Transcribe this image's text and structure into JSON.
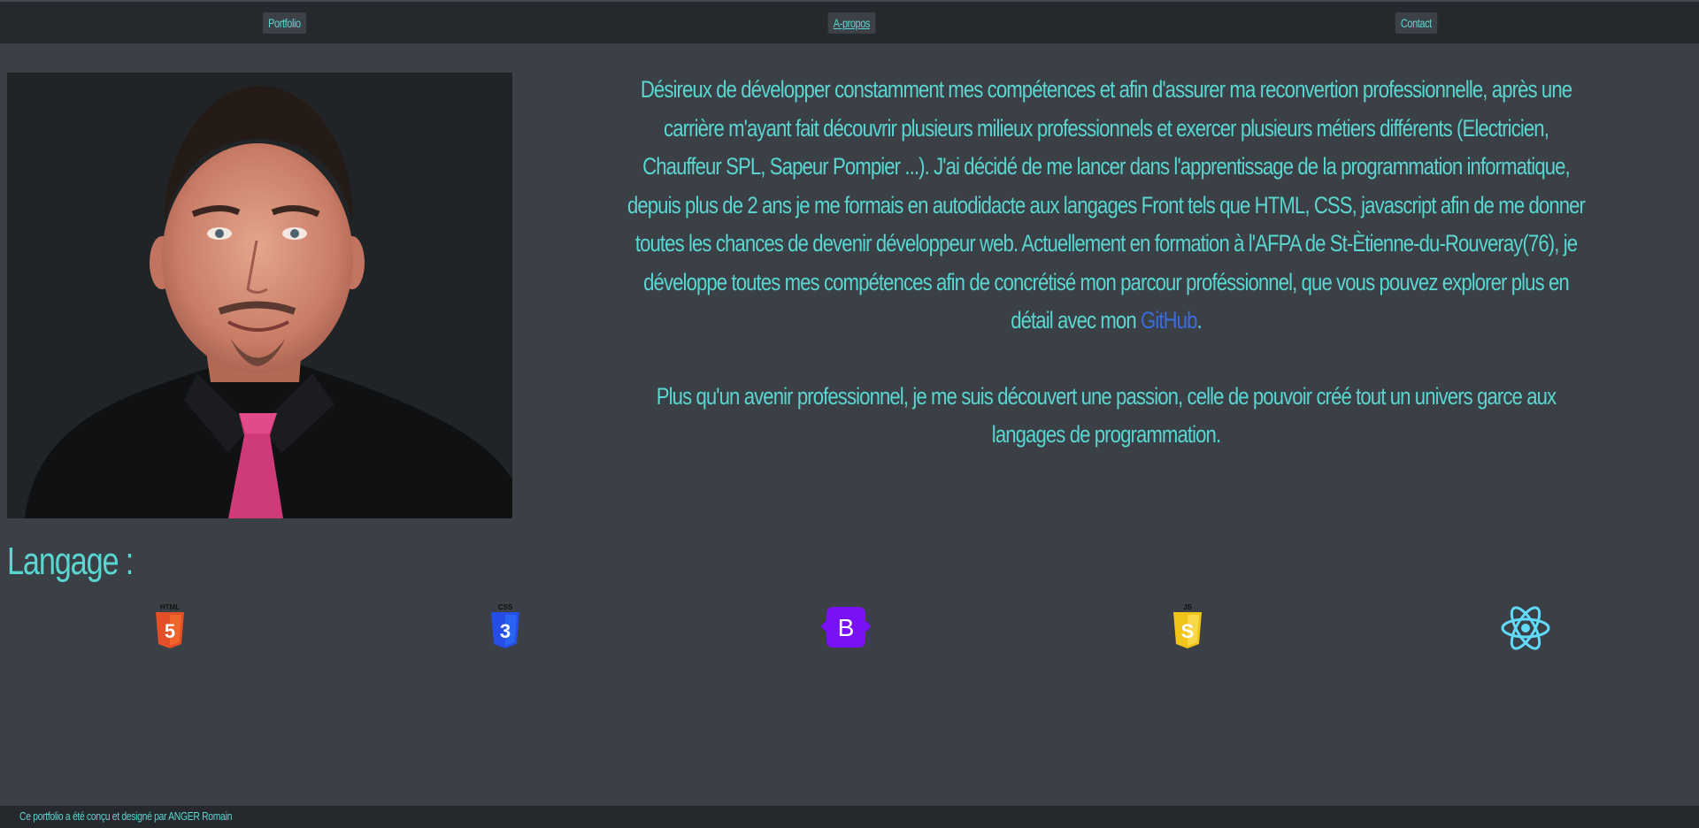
{
  "nav": {
    "items": [
      {
        "label": "Portfolio"
      },
      {
        "label": "A-propos"
      },
      {
        "label": "Contact"
      }
    ]
  },
  "about": {
    "paragraph1_text": "Désireux de développer constamment mes compétences et afin d'assurer ma reconvertion professionnelle, après une carrière m'ayant fait découvrir plusieurs milieux professionnels et exercer plusieurs métiers différents (Electricien, Chauffeur SPL, Sapeur Pompier ...). J'ai décidé de me lancer dans l'apprentissage de la programmation informatique, depuis plus de 2 ans je me formais en autodidacte aux langages Front tels que HTML, CSS, javascript afin de me donner toutes les chances de devenir développeur web. Actuellement en formation à l'AFPA de St-Ètienne-du-Rouveray(76), je développe toutes mes compétences afin de concrétisé mon parcour proféssionnel, que vous pouvez explorer plus en détail avec mon ",
    "github_link": "GitHub",
    "paragraph1_end": ".",
    "paragraph2": "Plus qu'un avenir professionnel, je me suis découvert une passion, celle de pouvoir créé tout un univers garce aux langages de programmation."
  },
  "languages": {
    "title": "Langage :",
    "icons": [
      {
        "name": "html5-icon",
        "caption": "HTML",
        "glyph": "5",
        "color": "#e34f26"
      },
      {
        "name": "css3-icon",
        "caption": "CSS",
        "glyph": "3",
        "color": "#264de4"
      },
      {
        "name": "bootstrap-icon",
        "glyph": "B",
        "color": "#7911f5"
      },
      {
        "name": "javascript-icon",
        "caption": "JS",
        "glyph": "S",
        "color": "#f0c419"
      },
      {
        "name": "react-icon",
        "color": "#61dafb"
      }
    ]
  },
  "footer": {
    "credit": "Ce portfolio a été conçu et designé par ANGER Romain"
  },
  "colors": {
    "background": "#3b3f46",
    "bar": "#25282c",
    "text_accent": "#5ad6d0",
    "link": "#3a6be0"
  }
}
